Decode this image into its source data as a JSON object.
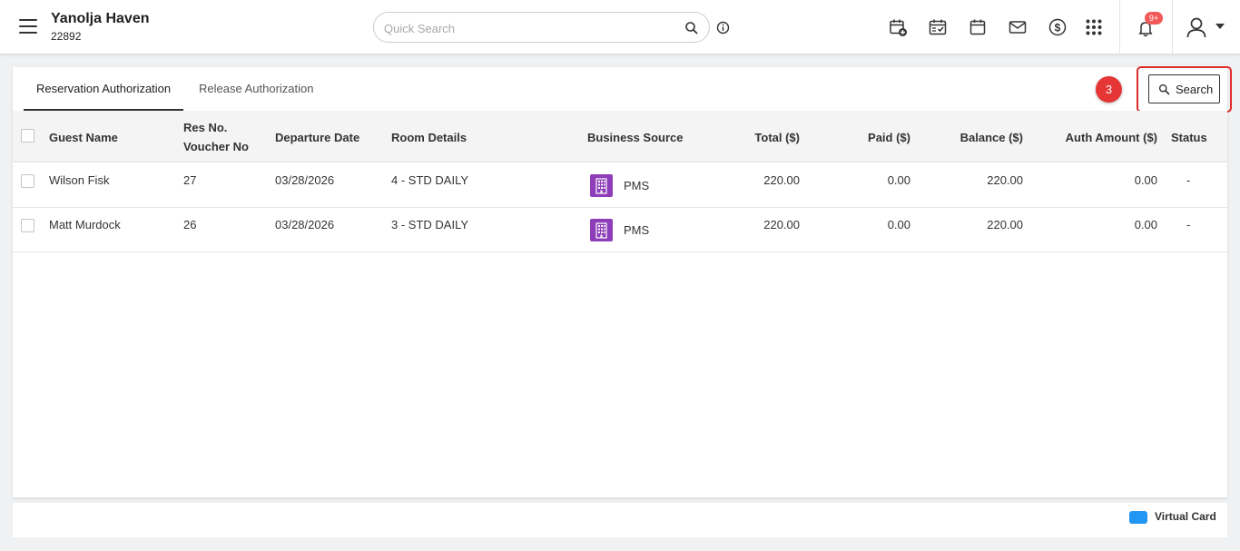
{
  "header": {
    "property_name": "Yanolja Haven",
    "property_id": "22892",
    "search_placeholder": "Quick Search",
    "notification_badge": "9+"
  },
  "tabs": [
    {
      "label": "Reservation Authorization",
      "active": true
    },
    {
      "label": "Release Authorization",
      "active": false
    }
  ],
  "step_badge": "3",
  "search_button_label": "Search",
  "table": {
    "columns": {
      "guest_name": "Guest Name",
      "res_no": "Res No.",
      "voucher_no": "Voucher No",
      "departure_date": "Departure Date",
      "room_details": "Room Details",
      "business_source": "Business Source",
      "total": "Total ($)",
      "paid": "Paid ($)",
      "balance": "Balance ($)",
      "auth_amount": "Auth Amount ($)",
      "status": "Status"
    },
    "rows": [
      {
        "guest_name": "Wilson Fisk",
        "res_no": "27",
        "departure_date": "03/28/2026",
        "room_details": "4 - STD DAILY",
        "business_source": "PMS",
        "total": "220.00",
        "paid": "0.00",
        "balance": "220.00",
        "auth_amount": "0.00",
        "status": "-"
      },
      {
        "guest_name": "Matt Murdock",
        "res_no": "26",
        "departure_date": "03/28/2026",
        "room_details": "3 - STD DAILY",
        "business_source": "PMS",
        "total": "220.00",
        "paid": "0.00",
        "balance": "220.00",
        "auth_amount": "0.00",
        "status": "-"
      }
    ]
  },
  "legend": {
    "virtual_card_label": "Virtual Card",
    "virtual_card_color": "#2196f3"
  },
  "colors": {
    "highlight": "#e02b2b",
    "business_source_icon": "#8d3eb8",
    "notification_badge": "#f25858"
  }
}
